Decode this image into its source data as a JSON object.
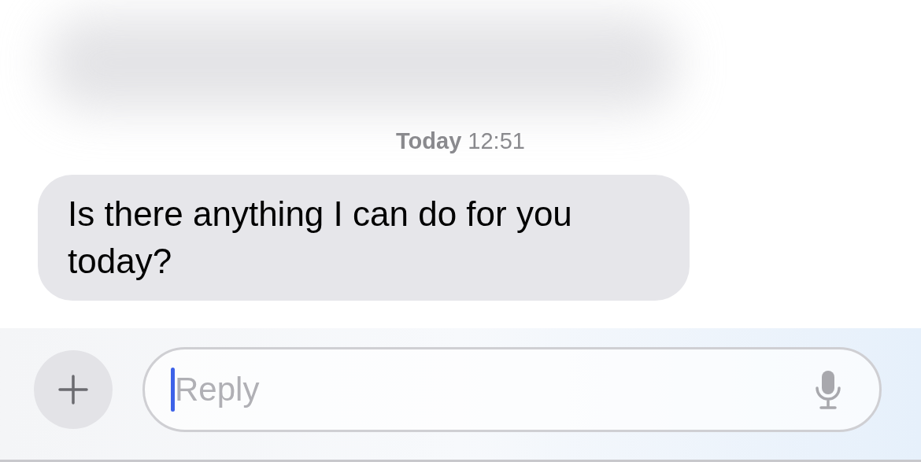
{
  "timestamp": "**Today** 12:51",
  "messages": [
    {
      "text": "Is there anything I can do for you today?",
      "kind": "incoming"
    }
  ],
  "composer": {
    "placeholder": "Reply",
    "focused": true
  }
}
